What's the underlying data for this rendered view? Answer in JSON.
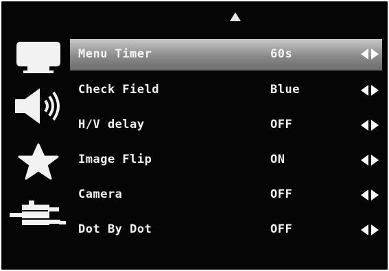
{
  "menu": {
    "items": [
      {
        "label": "Menu Timer",
        "value": "60s"
      },
      {
        "label": "Check Field",
        "value": "Blue"
      },
      {
        "label": "H/V delay",
        "value": "OFF"
      },
      {
        "label": "Image Flip",
        "value": "ON"
      },
      {
        "label": "Camera",
        "value": "OFF"
      },
      {
        "label": "Dot By Dot",
        "value": "OFF"
      }
    ],
    "selected_index": 0
  },
  "icons": {
    "scroll_up": "up-arrow-icon",
    "adjust": "left-right-arrows-icon",
    "sidebar": [
      "monitor-icon",
      "speaker-icon",
      "star-icon",
      "connector-icon"
    ]
  },
  "colors": {
    "background": "#050505",
    "text": "#f4f4f4",
    "highlight": "#8a8a8a"
  }
}
